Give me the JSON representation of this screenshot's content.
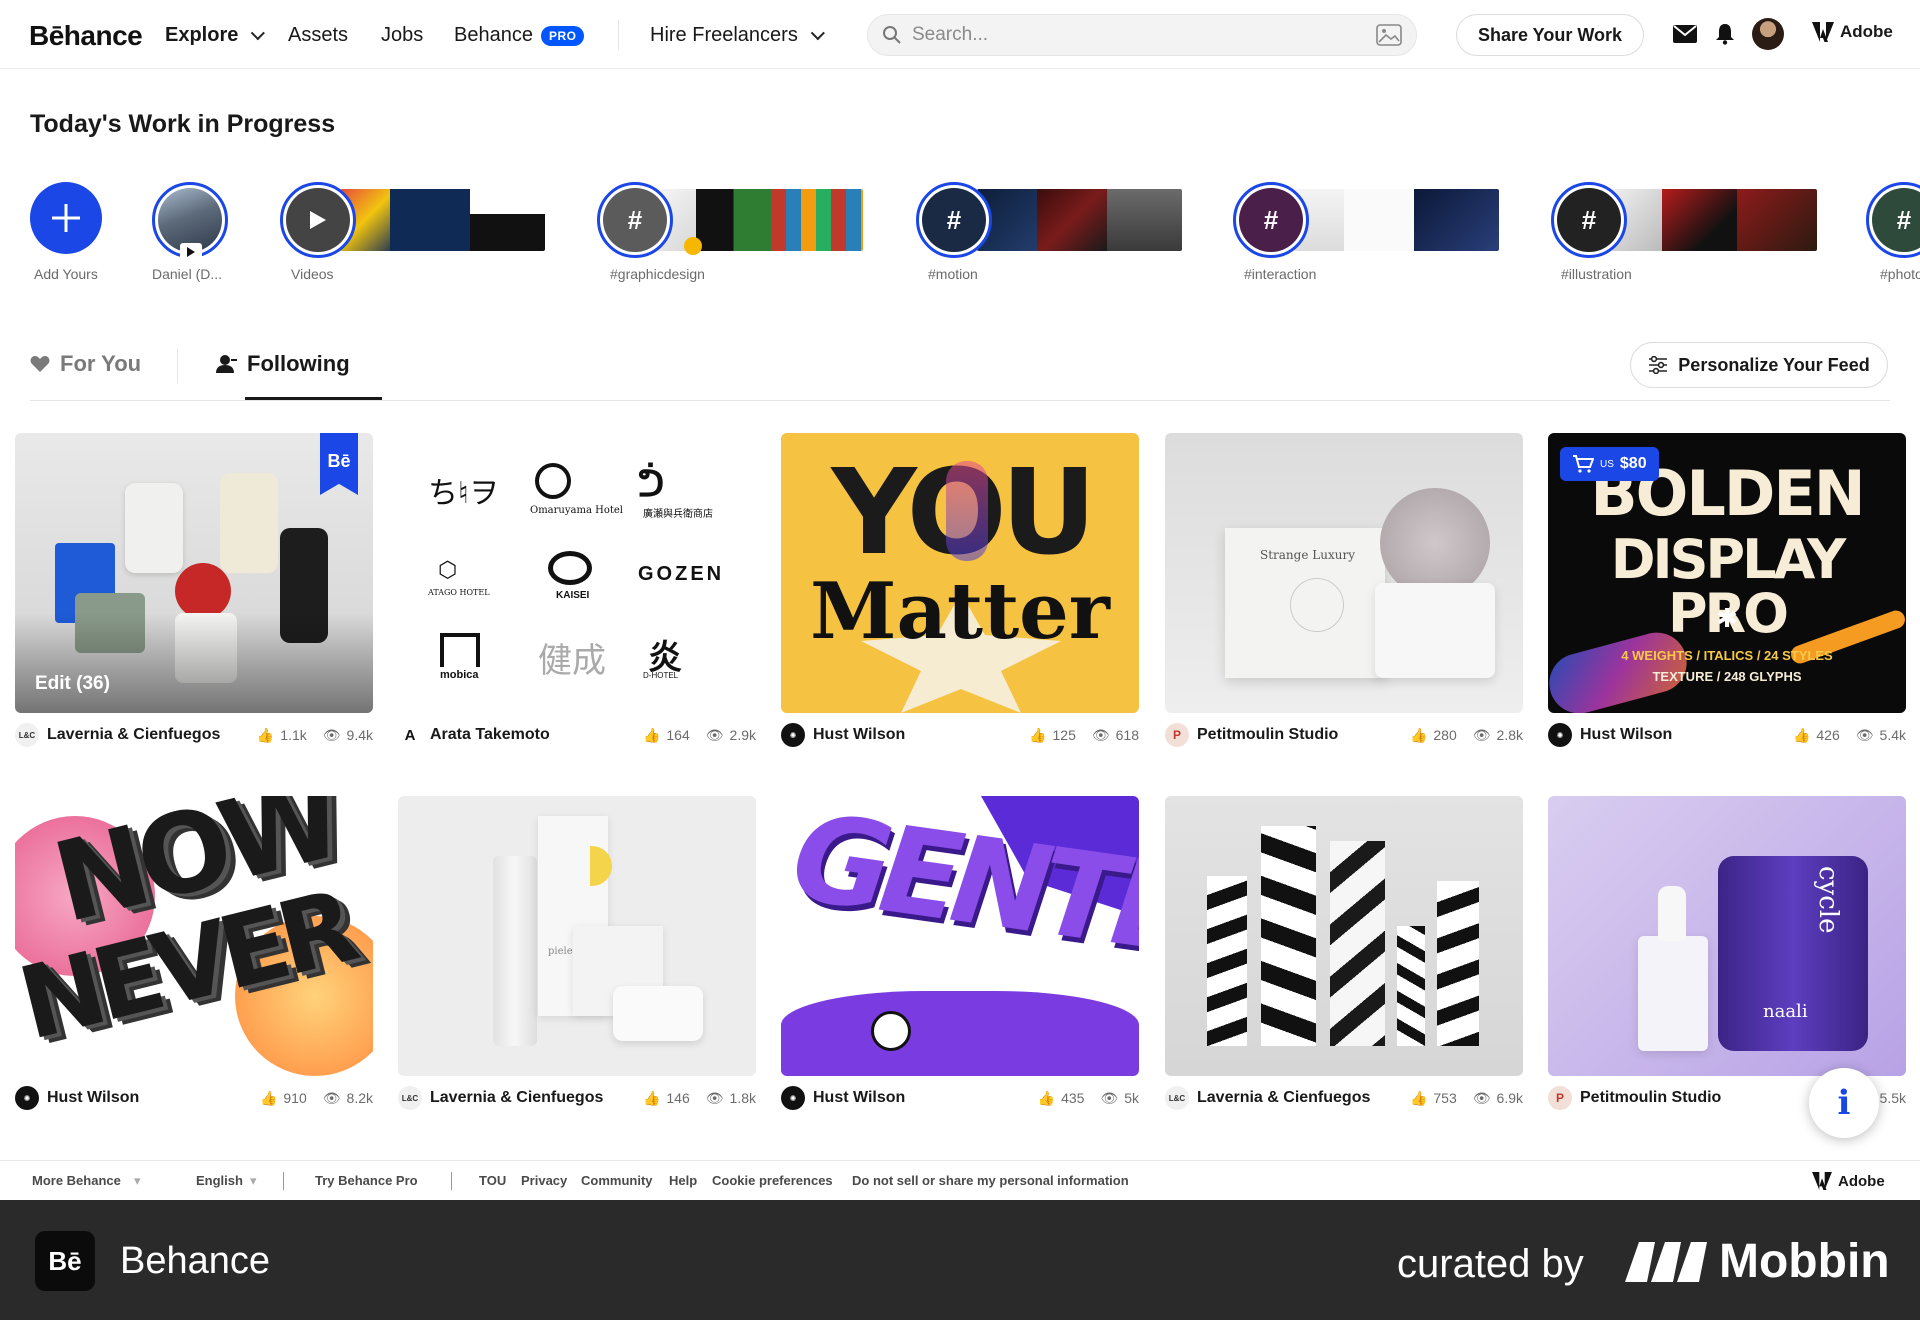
{
  "brand": {
    "logo": "Bēhance"
  },
  "nav": {
    "explore": "Explore",
    "assets": "Assets",
    "jobs": "Jobs",
    "behance_pro": "Behance",
    "pro_badge": "PRO",
    "hire": "Hire Freelancers",
    "search_placeholder": "Search...",
    "share": "Share Your Work",
    "adobe": "Adobe"
  },
  "wip": {
    "title": "Today's Work in Progress",
    "stories": [
      {
        "label": "Add Yours"
      },
      {
        "label": "Daniel (D..."
      },
      {
        "label": "Videos"
      },
      {
        "label": "#graphicdesign"
      },
      {
        "label": "#motion"
      },
      {
        "label": "#interaction"
      },
      {
        "label": "#illustration"
      },
      {
        "label": "#photo"
      }
    ]
  },
  "tabs": {
    "for_you": "For You",
    "following": "Following",
    "personalize": "Personalize Your Feed"
  },
  "projects": [
    {
      "owner": "Lavernia & Cienfuegos",
      "owner_initials": "L&C",
      "likes": "1.1k",
      "views": "9.4k",
      "overlay": "Edit (36)"
    },
    {
      "owner": "Arata Takemoto",
      "owner_initials": "A",
      "likes": "164",
      "views": "2.9k"
    },
    {
      "owner": "Hust Wilson",
      "owner_initials": "",
      "likes": "125",
      "views": "618"
    },
    {
      "owner": "Petitmoulin Studio",
      "owner_initials": "P",
      "likes": "280",
      "views": "2.8k"
    },
    {
      "owner": "Hust Wilson",
      "owner_initials": "",
      "likes": "426",
      "views": "5.4k",
      "price_prefix": "US",
      "price": "$80"
    },
    {
      "owner": "Hust Wilson",
      "owner_initials": "",
      "likes": "910",
      "views": "8.2k"
    },
    {
      "owner": "Lavernia & Cienfuegos",
      "owner_initials": "L&C",
      "likes": "146",
      "views": "1.8k"
    },
    {
      "owner": "Hust Wilson",
      "owner_initials": "",
      "likes": "435",
      "views": "5k"
    },
    {
      "owner": "Lavernia & Cienfuegos",
      "owner_initials": "L&C",
      "likes": "753",
      "views": "6.9k"
    },
    {
      "owner": "Petitmoulin Studio",
      "owner_initials": "P",
      "likes": "",
      "views": "5.5k"
    }
  ],
  "thumb_text": {
    "you": "YOU",
    "matter": "Matter",
    "bolden1": "BOLDEN",
    "bolden2": "DISPLAY PRO",
    "bolden3": "4 WEIGHTS / ITALICS / 24 STYLES",
    "bolden4": "TEXTURE / 248 GLYPHS",
    "now": "NOW",
    "never": "NEVER",
    "gentle": "GENTLE",
    "strange": "Strange Luxury",
    "piele": "piele",
    "naali": "naali",
    "cycle": "cycle",
    "be_badge": "Bē",
    "logos": [
      "Omaruyama Hotel",
      "ATAGO HOTEL",
      "KAISEI",
      "GOZEN",
      "mobica",
      "D-HOTEL",
      "廣瀬與兵衛商店",
      "健成"
    ]
  },
  "footer": {
    "more": "More Behance",
    "english": "English",
    "try_pro": "Try Behance Pro",
    "tou": "TOU",
    "privacy": "Privacy",
    "community": "Community",
    "help": "Help",
    "cookie": "Cookie preferences",
    "dnsmpi": "Do not sell or share my personal information",
    "adobe": "Adobe"
  },
  "banner": {
    "logo": "Bē",
    "app_name": "Behance",
    "curated": "curated by",
    "mobbin": "Mobbin"
  },
  "colors": {
    "accent": "#1a47e6",
    "pro_blue": "#0057ff",
    "banner_bg": "#2a2a2a"
  }
}
